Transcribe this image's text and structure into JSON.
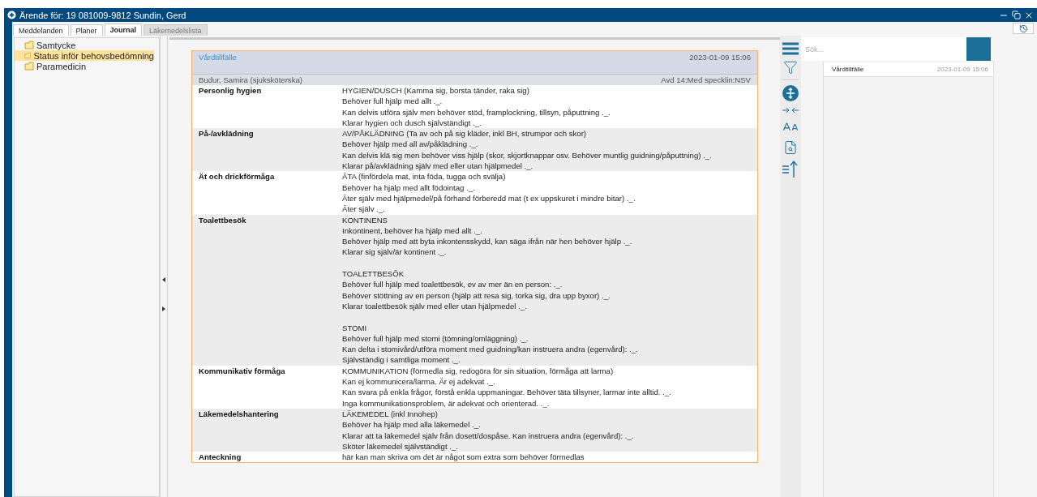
{
  "window": {
    "title": "Ärende för: 19 081009-9812 Sundin, Gerd"
  },
  "tabs": [
    {
      "label": "Meddelanden",
      "selected": false,
      "disabled": false
    },
    {
      "label": "Planer",
      "selected": false,
      "disabled": false
    },
    {
      "label": "Journal",
      "selected": true,
      "disabled": false
    },
    {
      "label": "Läkemedelslista",
      "selected": false,
      "disabled": true
    }
  ],
  "tree": [
    {
      "label": "Samtycke",
      "selected": false
    },
    {
      "label": "Status inför behovsbedömning",
      "selected": true
    },
    {
      "label": "Paramedicin",
      "selected": false
    }
  ],
  "record": {
    "title": "Vårdtillfälle",
    "date": "2023-01-09 15:06",
    "author": "Budur, Samira (sjuksköterska)",
    "unit": "Avd 14:Med specklin:NSV",
    "sections": [
      {
        "label": "Personlig hygien",
        "groups": [
          [
            "HYGIEN/DUSCH (Kamma sig, borsta tänder, raka sig)",
            "Behöver full hjälp med allt ._.",
            "Kan delvis utföra själv men behöver stöd, framplockning, tillsyn, påputtning ._.",
            "Klarar hygien och dusch självständigt ._."
          ]
        ]
      },
      {
        "label": "På-/avklädning",
        "groups": [
          [
            "AV/PÅKLÄDNING (Ta av och på sig kläder, inkl BH, strumpor och skor)",
            "Behöver hjälp med all av/påklädning ._.",
            "Kan delvis klä sig men behöver viss hjälp (skor, skjortknappar osv. Behöver muntlig guidning/påputtning) ._.",
            "Klarar på/avklädning själv med eller utan hjälpmedel ._."
          ]
        ]
      },
      {
        "label": "Ät och drickförmåga",
        "groups": [
          [
            "ÄTA (finfördela mat, inta föda, tugga och svälja)",
            "Behöver ha hjälp med allt födointag ._.",
            "Äter själv med hjälpmedel/på förhand förberedd mat (t ex uppskuret i mindre bitar) ._.",
            "Äter själv ._."
          ]
        ]
      },
      {
        "label": "Toalettbesök",
        "groups": [
          [
            "KONTINENS",
            "Inkontinent, behöver ha hjälp med allt ._.",
            "Behöver hjälp med att byta inkontensskydd, kan säga ifrån när hen behöver hjälp ._.",
            "Klarar sig själv/är kontinent ._."
          ],
          [
            "TOALETTBESÖK",
            "Behöver full hjälp med toalettbesök, ev av mer än en person: ._.",
            "Behöver stöttning av en person (hjälp att resa sig, torka sig, dra upp byxor) ._.",
            "Klarar toalettbesök själv med eller utan hjälpmedel ._."
          ],
          [
            "STOMI",
            "Behöver full hjälp med stomi (tömning/omläggning) ._.",
            "Kan delta i stomivård/utföra moment med guidning/kan instruera andra  (egenvård): ._.",
            "Självständig i samtliga moment ._."
          ]
        ]
      },
      {
        "label": "Kommunikativ förmåga",
        "groups": [
          [
            "KOMMUNIKATION (förmedla sig, redogöra för sin situation, förmåga att larma)",
            "Kan ej kommunicera/larma. Är ej adekvat ._.",
            "Kan svara på enkla frågor, förstå enkla uppmaningar. Behöver täta tillsyner, larmar inte alltid. ._.",
            "Inga kommunikationsproblem, är adekvat och orienterad. ._."
          ]
        ]
      },
      {
        "label": "Läkemedelshantering",
        "groups": [
          [
            "LÄKEMEDEL (inkl Innohep)",
            "Behöver ha hjälp med alla läkemedel ._.",
            "Klarar att ta läkemedel själv från dosett/dospåse. Kan instruera andra (egenvård): ._.",
            "Sköter läkemedel självständigt ._."
          ]
        ]
      },
      {
        "label": "Anteckning",
        "groups": [
          [
            "här kan man skriva om det är något som extra som behöver förmedlas"
          ]
        ]
      }
    ]
  },
  "search": {
    "placeholder": "Sök..."
  },
  "results": [
    {
      "title": "Vårdtillfälle",
      "date": "2023-01-09 15:06",
      "selected": false
    }
  ]
}
